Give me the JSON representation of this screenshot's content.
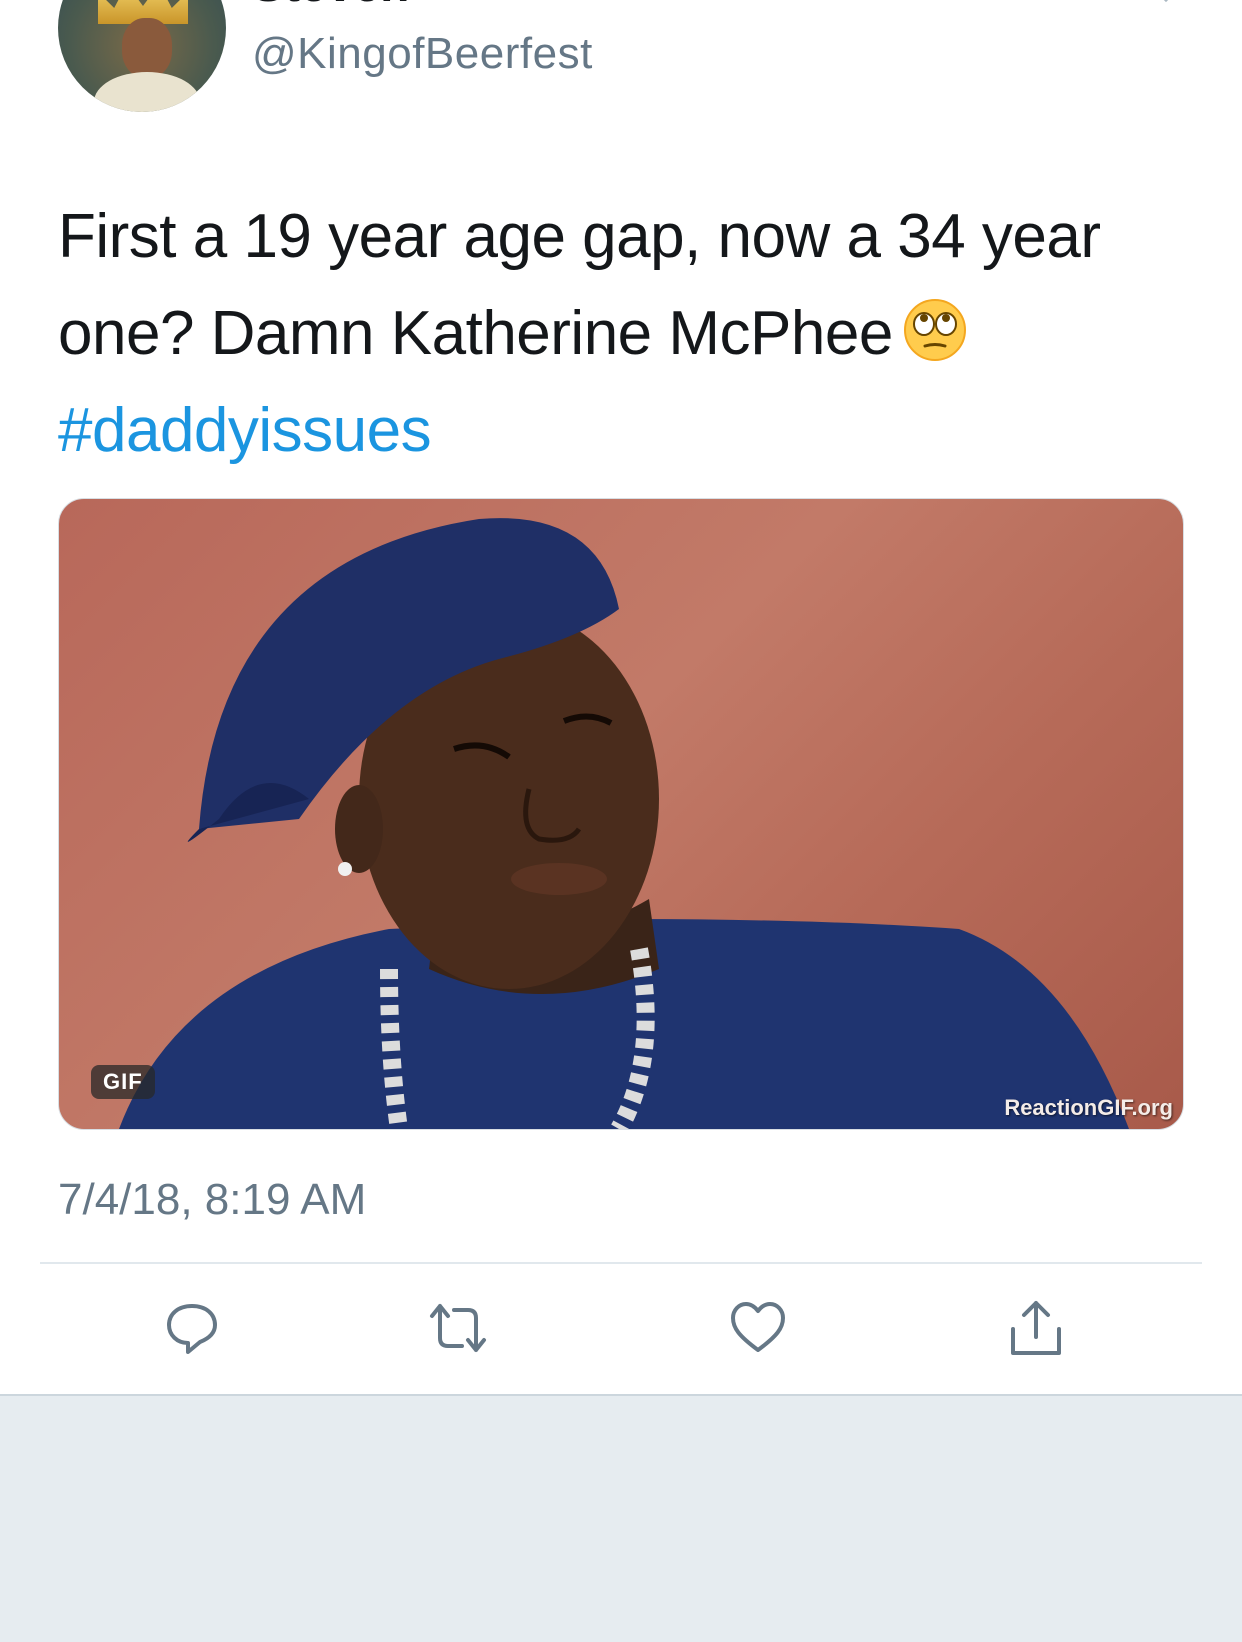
{
  "tweet": {
    "display_name": "Steven",
    "handle": "@KingofBeerfest",
    "text_line1": "First a 19 year age gap, now a 34 year",
    "text_line2": "one? Damn Katherine McPhee",
    "hashtag": "#daddyissues",
    "media": {
      "badge": "GIF",
      "watermark": "ReactionGIF.org"
    },
    "timestamp": "7/4/18, 8:19 AM"
  },
  "actions": [
    {
      "name": "reply",
      "icon": "reply-icon"
    },
    {
      "name": "retweet",
      "icon": "retweet-icon"
    },
    {
      "name": "like",
      "icon": "heart-icon"
    },
    {
      "name": "share",
      "icon": "share-icon"
    }
  ],
  "colors": {
    "text": "#14171a",
    "secondary": "#657786",
    "link": "#1b95e0",
    "divider": "#e1e8ed",
    "footer_bg": "#e6ecf0"
  }
}
